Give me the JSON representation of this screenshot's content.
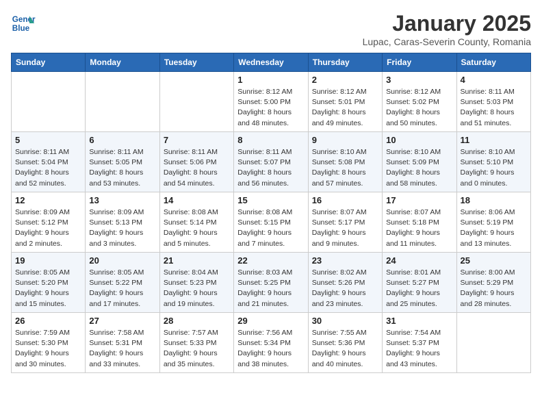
{
  "header": {
    "logo_line1": "General",
    "logo_line2": "Blue",
    "month": "January 2025",
    "location": "Lupac, Caras-Severin County, Romania"
  },
  "weekdays": [
    "Sunday",
    "Monday",
    "Tuesday",
    "Wednesday",
    "Thursday",
    "Friday",
    "Saturday"
  ],
  "weeks": [
    [
      {
        "day": "",
        "info": ""
      },
      {
        "day": "",
        "info": ""
      },
      {
        "day": "",
        "info": ""
      },
      {
        "day": "1",
        "info": "Sunrise: 8:12 AM\nSunset: 5:00 PM\nDaylight: 8 hours\nand 48 minutes."
      },
      {
        "day": "2",
        "info": "Sunrise: 8:12 AM\nSunset: 5:01 PM\nDaylight: 8 hours\nand 49 minutes."
      },
      {
        "day": "3",
        "info": "Sunrise: 8:12 AM\nSunset: 5:02 PM\nDaylight: 8 hours\nand 50 minutes."
      },
      {
        "day": "4",
        "info": "Sunrise: 8:11 AM\nSunset: 5:03 PM\nDaylight: 8 hours\nand 51 minutes."
      }
    ],
    [
      {
        "day": "5",
        "info": "Sunrise: 8:11 AM\nSunset: 5:04 PM\nDaylight: 8 hours\nand 52 minutes."
      },
      {
        "day": "6",
        "info": "Sunrise: 8:11 AM\nSunset: 5:05 PM\nDaylight: 8 hours\nand 53 minutes."
      },
      {
        "day": "7",
        "info": "Sunrise: 8:11 AM\nSunset: 5:06 PM\nDaylight: 8 hours\nand 54 minutes."
      },
      {
        "day": "8",
        "info": "Sunrise: 8:11 AM\nSunset: 5:07 PM\nDaylight: 8 hours\nand 56 minutes."
      },
      {
        "day": "9",
        "info": "Sunrise: 8:10 AM\nSunset: 5:08 PM\nDaylight: 8 hours\nand 57 minutes."
      },
      {
        "day": "10",
        "info": "Sunrise: 8:10 AM\nSunset: 5:09 PM\nDaylight: 8 hours\nand 58 minutes."
      },
      {
        "day": "11",
        "info": "Sunrise: 8:10 AM\nSunset: 5:10 PM\nDaylight: 9 hours\nand 0 minutes."
      }
    ],
    [
      {
        "day": "12",
        "info": "Sunrise: 8:09 AM\nSunset: 5:12 PM\nDaylight: 9 hours\nand 2 minutes."
      },
      {
        "day": "13",
        "info": "Sunrise: 8:09 AM\nSunset: 5:13 PM\nDaylight: 9 hours\nand 3 minutes."
      },
      {
        "day": "14",
        "info": "Sunrise: 8:08 AM\nSunset: 5:14 PM\nDaylight: 9 hours\nand 5 minutes."
      },
      {
        "day": "15",
        "info": "Sunrise: 8:08 AM\nSunset: 5:15 PM\nDaylight: 9 hours\nand 7 minutes."
      },
      {
        "day": "16",
        "info": "Sunrise: 8:07 AM\nSunset: 5:17 PM\nDaylight: 9 hours\nand 9 minutes."
      },
      {
        "day": "17",
        "info": "Sunrise: 8:07 AM\nSunset: 5:18 PM\nDaylight: 9 hours\nand 11 minutes."
      },
      {
        "day": "18",
        "info": "Sunrise: 8:06 AM\nSunset: 5:19 PM\nDaylight: 9 hours\nand 13 minutes."
      }
    ],
    [
      {
        "day": "19",
        "info": "Sunrise: 8:05 AM\nSunset: 5:20 PM\nDaylight: 9 hours\nand 15 minutes."
      },
      {
        "day": "20",
        "info": "Sunrise: 8:05 AM\nSunset: 5:22 PM\nDaylight: 9 hours\nand 17 minutes."
      },
      {
        "day": "21",
        "info": "Sunrise: 8:04 AM\nSunset: 5:23 PM\nDaylight: 9 hours\nand 19 minutes."
      },
      {
        "day": "22",
        "info": "Sunrise: 8:03 AM\nSunset: 5:25 PM\nDaylight: 9 hours\nand 21 minutes."
      },
      {
        "day": "23",
        "info": "Sunrise: 8:02 AM\nSunset: 5:26 PM\nDaylight: 9 hours\nand 23 minutes."
      },
      {
        "day": "24",
        "info": "Sunrise: 8:01 AM\nSunset: 5:27 PM\nDaylight: 9 hours\nand 25 minutes."
      },
      {
        "day": "25",
        "info": "Sunrise: 8:00 AM\nSunset: 5:29 PM\nDaylight: 9 hours\nand 28 minutes."
      }
    ],
    [
      {
        "day": "26",
        "info": "Sunrise: 7:59 AM\nSunset: 5:30 PM\nDaylight: 9 hours\nand 30 minutes."
      },
      {
        "day": "27",
        "info": "Sunrise: 7:58 AM\nSunset: 5:31 PM\nDaylight: 9 hours\nand 33 minutes."
      },
      {
        "day": "28",
        "info": "Sunrise: 7:57 AM\nSunset: 5:33 PM\nDaylight: 9 hours\nand 35 minutes."
      },
      {
        "day": "29",
        "info": "Sunrise: 7:56 AM\nSunset: 5:34 PM\nDaylight: 9 hours\nand 38 minutes."
      },
      {
        "day": "30",
        "info": "Sunrise: 7:55 AM\nSunset: 5:36 PM\nDaylight: 9 hours\nand 40 minutes."
      },
      {
        "day": "31",
        "info": "Sunrise: 7:54 AM\nSunset: 5:37 PM\nDaylight: 9 hours\nand 43 minutes."
      },
      {
        "day": "",
        "info": ""
      }
    ]
  ]
}
